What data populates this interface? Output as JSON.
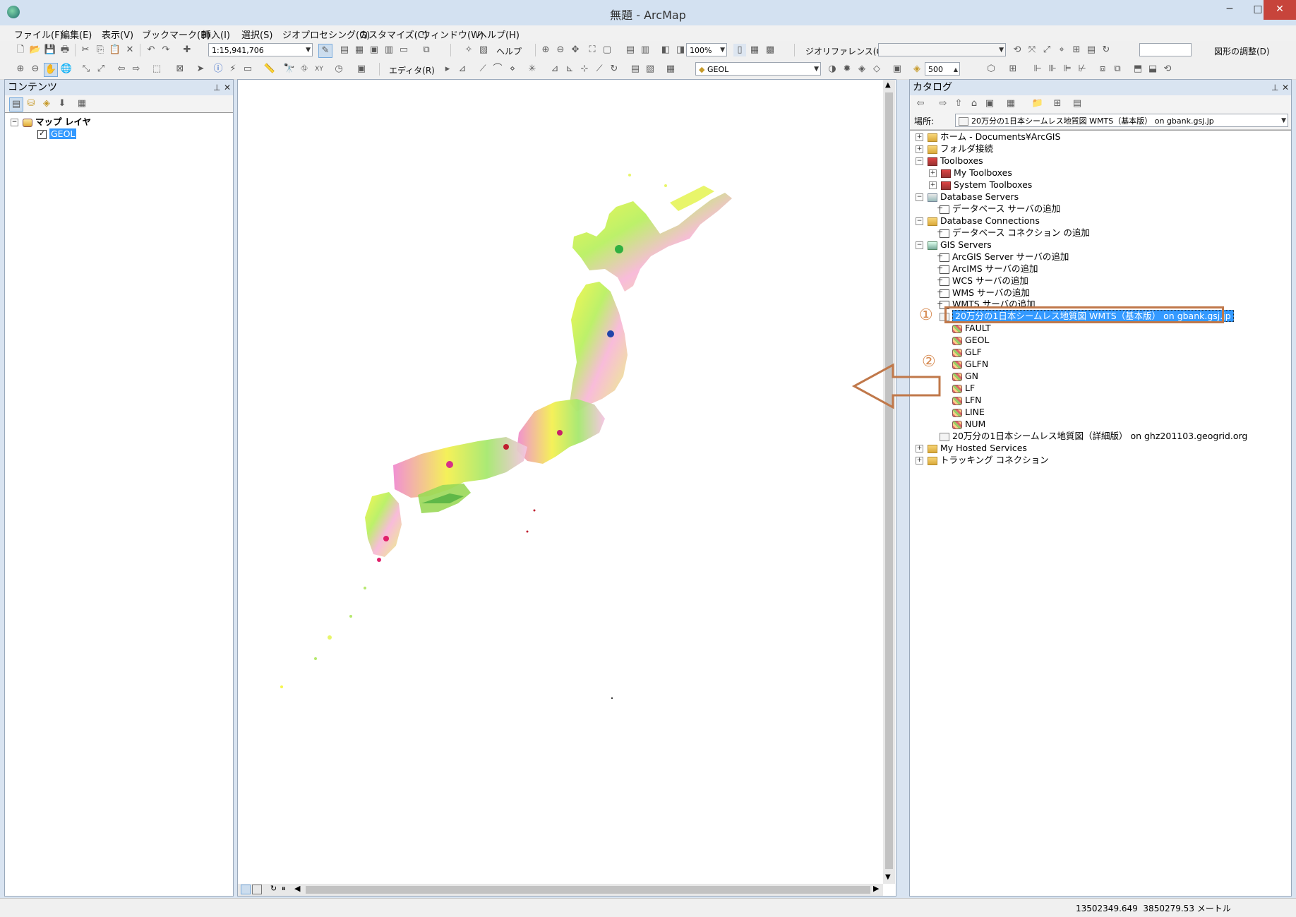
{
  "window": {
    "title": "無題 - ArcMap"
  },
  "menu": [
    "ファイル(F)",
    "編集(E)",
    "表示(V)",
    "ブックマーク(B)",
    "挿入(I)",
    "選択(S)",
    "ジオプロセシング(G)",
    "カスタマイズ(C)",
    "ウィンドウ(W)",
    "ヘルプ(H)"
  ],
  "toolbar1": {
    "scale": "1:15,941,706",
    "help_label": "ヘルプ",
    "zoom_percent": "100%",
    "georef_label": "ジオリファレンス(G)",
    "shape_adjust_label": "図形の調整(D)"
  },
  "toolbar2": {
    "editor_label": "エディタ(R)",
    "layer_combo": "GEOL",
    "value_box": "500"
  },
  "toc": {
    "title": "コンテンツ",
    "root_label": "マップ レイヤ",
    "layer_label": "GEOL",
    "layer_checked": true
  },
  "catalog": {
    "title": "カタログ",
    "location_label": "場所:",
    "location_value": "20万分の1日本シームレス地質図 WMTS（基本版） on gbank.gsj.jp",
    "items": [
      {
        "label": "ホーム - Documents¥ArcGIS",
        "icon": "folder-icon",
        "expander": "+"
      },
      {
        "label": "フォルダ接続",
        "icon": "folder-icon",
        "expander": "+"
      },
      {
        "label": "Toolboxes",
        "icon": "toolbox-icon",
        "expander": "−"
      },
      {
        "label": "My Toolboxes",
        "icon": "toolbox-icon",
        "expander": "+"
      },
      {
        "label": "System Toolboxes",
        "icon": "toolbox-icon",
        "expander": "+"
      },
      {
        "label": "Database Servers",
        "icon": "database-icon",
        "expander": "−"
      },
      {
        "label": "データベース サーバの追加",
        "icon": "add-icon",
        "expander": ""
      },
      {
        "label": "Database Connections",
        "icon": "database-icon",
        "expander": "−"
      },
      {
        "label": "データベース コネクション の追加",
        "icon": "add-icon",
        "expander": ""
      },
      {
        "label": "GIS Servers",
        "icon": "server-icon",
        "expander": "−"
      },
      {
        "label": "ArcGIS Server サーバの追加",
        "icon": "add-icon",
        "expander": ""
      },
      {
        "label": "ArcIMS サーバの追加",
        "icon": "add-icon",
        "expander": ""
      },
      {
        "label": "WCS サーバの追加",
        "icon": "add-icon",
        "expander": ""
      },
      {
        "label": "WMS サーバの追加",
        "icon": "add-icon",
        "expander": ""
      },
      {
        "label": "WMTS サーバの追加",
        "icon": "add-icon",
        "expander": ""
      },
      {
        "label": "20万分の1日本シームレス地質図 WMTS（基本版） on gbank.gsj.jp",
        "icon": "service-icon",
        "expander": "−"
      },
      {
        "label": "FAULT",
        "icon": "layer-icon",
        "expander": ""
      },
      {
        "label": "GEOL",
        "icon": "layer-icon",
        "expander": ""
      },
      {
        "label": "GLF",
        "icon": "layer-icon",
        "expander": ""
      },
      {
        "label": "GLFN",
        "icon": "layer-icon",
        "expander": ""
      },
      {
        "label": "GN",
        "icon": "layer-icon",
        "expander": ""
      },
      {
        "label": "LF",
        "icon": "layer-icon",
        "expander": ""
      },
      {
        "label": "LFN",
        "icon": "layer-icon",
        "expander": ""
      },
      {
        "label": "LINE",
        "icon": "layer-icon",
        "expander": ""
      },
      {
        "label": "NUM",
        "icon": "layer-icon",
        "expander": ""
      },
      {
        "label": "20万分の1日本シームレス地質図（詳細版） on ghz201103.geogrid.org",
        "icon": "service-icon",
        "expander": ""
      },
      {
        "label": "My Hosted Services",
        "icon": "folder-icon",
        "expander": "+"
      },
      {
        "label": "トラッキング コネクション",
        "icon": "folder-icon",
        "expander": "+"
      }
    ]
  },
  "annotations": {
    "marker1": "①",
    "marker2": "②"
  },
  "status": {
    "coords": "13502349.649  3850279.53 メートル"
  },
  "colors": {
    "highlight": "#3399ff",
    "annotation": "#c0784a"
  }
}
